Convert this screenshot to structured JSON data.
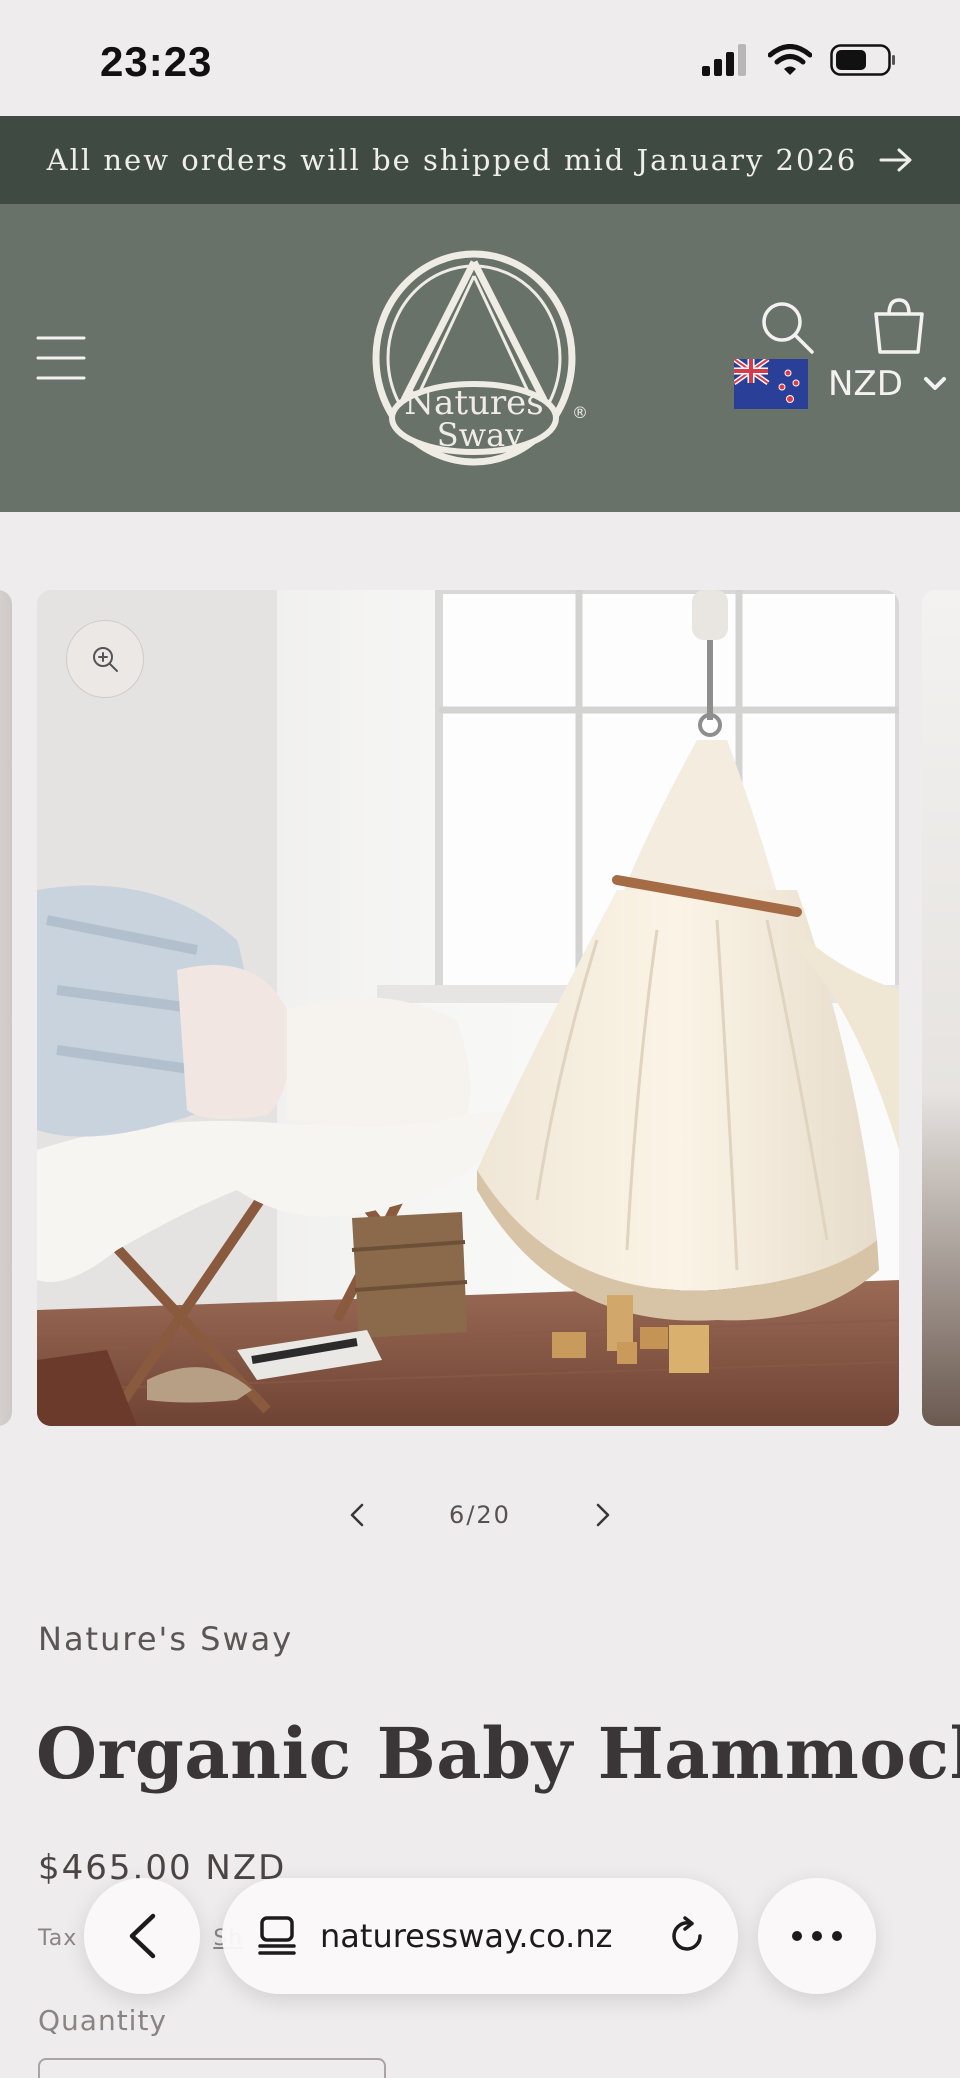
{
  "status_bar": {
    "time": "23:23"
  },
  "announcement": {
    "text": "All new orders will be shipped mid January 2026"
  },
  "header": {
    "logo_text_line1": "Natures",
    "logo_text_line2": "Sway",
    "logo_mark": "®",
    "currency_code": "NZD"
  },
  "gallery": {
    "current": "6/20"
  },
  "product": {
    "vendor": "Nature's Sway",
    "title": "Organic Baby Hammock",
    "price": "$465.00 NZD",
    "tax_prefix": "Tax",
    "tax_link": "Sh",
    "quantity_label": "Quantity"
  },
  "browser": {
    "url": "naturessway.co.nz"
  },
  "colors": {
    "announcement_bg": "#3f4b42",
    "header_bg": "#687268",
    "page_bg": "#efeced"
  }
}
